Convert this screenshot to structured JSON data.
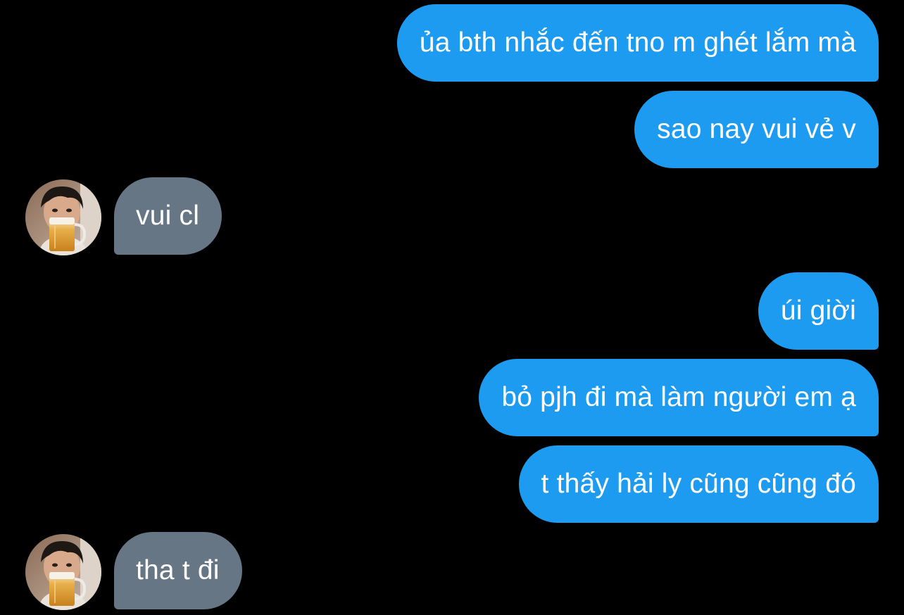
{
  "colors": {
    "background": "#000000",
    "outgoing_bubble": "#1d9bf0",
    "incoming_bubble": "#667685",
    "text": "#ffffff"
  },
  "avatar_icon": "contact-avatar-photo",
  "messages": [
    {
      "direction": "outgoing",
      "text": "ủa bth nhắc đến tno m ghét lắm mà"
    },
    {
      "direction": "outgoing",
      "text": "sao nay vui vẻ v"
    },
    {
      "direction": "incoming",
      "text": "vui cl"
    },
    {
      "direction": "outgoing",
      "text": "úi giời"
    },
    {
      "direction": "outgoing",
      "text": "bỏ pjh đi mà làm người em ạ"
    },
    {
      "direction": "outgoing",
      "text": "t thấy hải ly cũng cũng đó"
    },
    {
      "direction": "incoming",
      "text": "tha t đi"
    }
  ]
}
